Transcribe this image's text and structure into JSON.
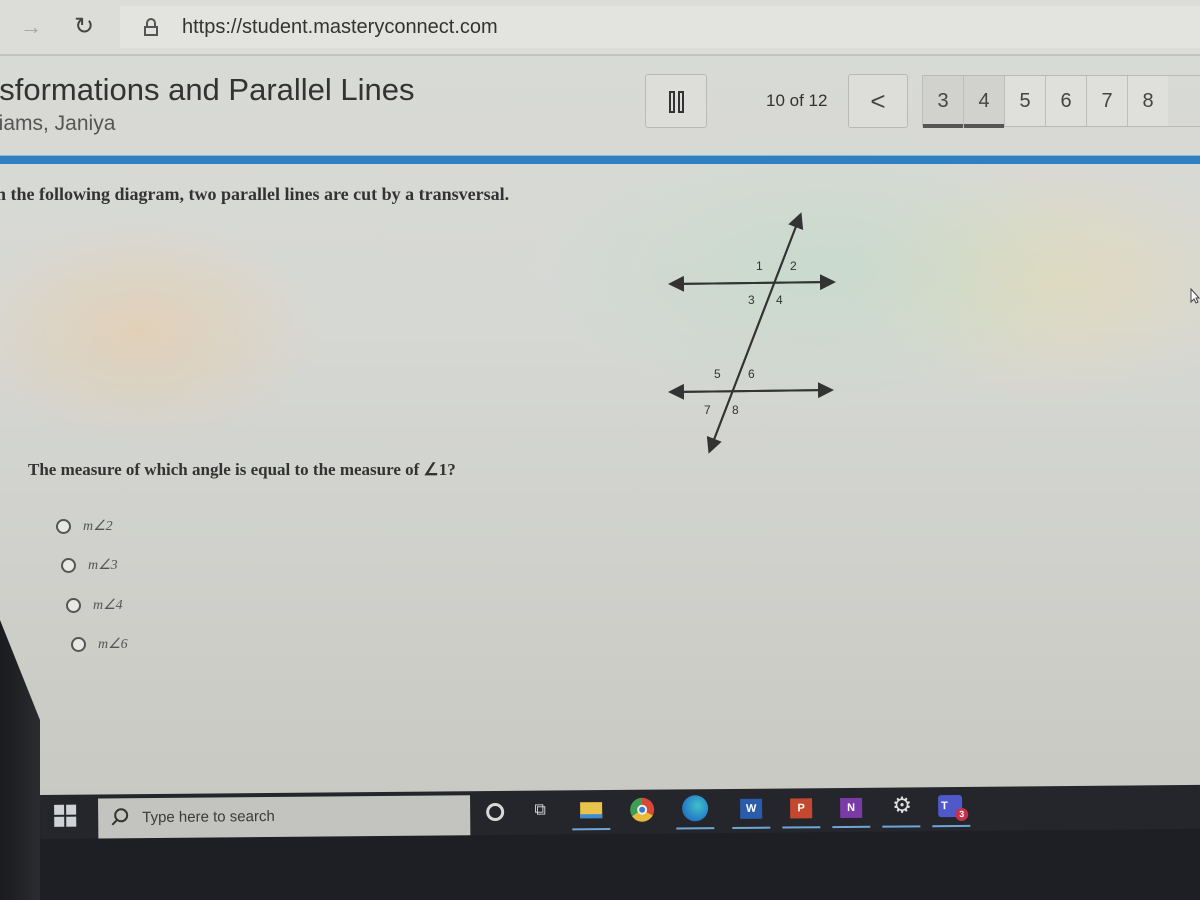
{
  "browser": {
    "url": "https://student.masteryconnect.com"
  },
  "assessment": {
    "title": "nsformations and Parallel Lines",
    "student": "liams, Janiya",
    "progress_text": "10 of 12",
    "prev_label": "<",
    "pages": [
      {
        "label": "3",
        "current": true
      },
      {
        "label": "4",
        "current": true
      },
      {
        "label": "5",
        "current": false
      },
      {
        "label": "6",
        "current": false
      },
      {
        "label": "7",
        "current": false
      },
      {
        "label": "8",
        "current": false
      }
    ]
  },
  "question": {
    "intro": "n the following diagram, two parallel lines are cut by a transversal.",
    "diagram_angle_labels": [
      "1",
      "2",
      "3",
      "4",
      "5",
      "6",
      "7",
      "8"
    ],
    "prompt": "The measure of which angle is equal to the measure of ∠1?",
    "choices": [
      {
        "label": "m∠2",
        "selected": false
      },
      {
        "label": "m∠3",
        "selected": false
      },
      {
        "label": "m∠4",
        "selected": false
      },
      {
        "label": "m∠6",
        "selected": false
      }
    ]
  },
  "taskbar": {
    "search_placeholder": "Type here to search",
    "apps": [
      "cortana",
      "task-view",
      "file-explorer",
      "chrome",
      "edge",
      "word",
      "powerpoint",
      "onenote",
      "settings",
      "teams"
    ],
    "word_letter": "W",
    "ppt_letter": "P",
    "onenote_letter": "N",
    "teams_letter": "T",
    "teams_badge": "3"
  },
  "colors": {
    "accent_rule": "#2f7fc1",
    "taskbar": "#24262b"
  }
}
